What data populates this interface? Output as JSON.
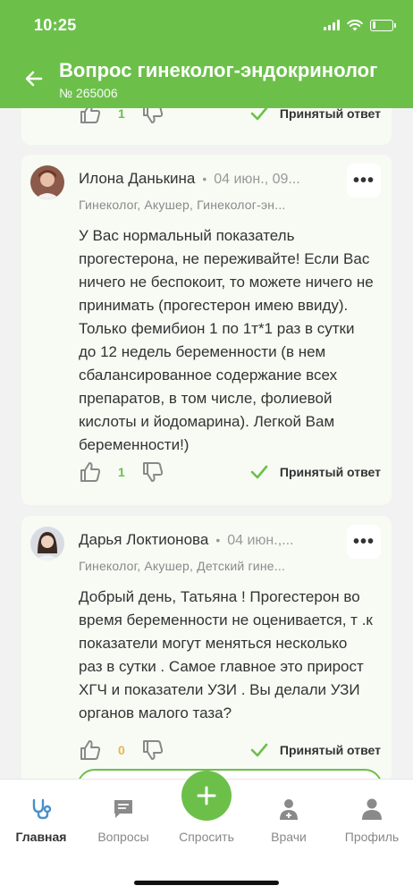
{
  "status_bar": {
    "time": "10:25"
  },
  "header": {
    "title": "Вопрос гинеколог-эндокринолог",
    "subtitle": "№ 265006"
  },
  "top_card": {
    "likes": "1",
    "accepted_label": "Принятый ответ"
  },
  "answers": [
    {
      "name": "Илона Данькина",
      "date": "04 июн., 09...",
      "specialty": "Гинеколог, Акушер, Гинеколог-эн...",
      "text": "У Вас нормальный показатель прогестерона, не переживайте! Если Вас ничего не беспокоит, то можете ничего не принимать (прогестерон имею ввиду). Только фемибион 1 по 1т*1 раз в сутки до 12 недель беременности (в нем сбалансированное содержание всех препаратов, в том числе, фолиевой кислоты и йодомарина). Легкой Вам беременности!)",
      "likes": "1",
      "accepted_label": "Принятый ответ"
    },
    {
      "name": "Дарья Локтионова",
      "date": "04 июн.,...",
      "specialty": "Гинеколог, Акушер, Детский гине...",
      "text": "Добрый день, Татьяна ! Прогестерон во время беременности не оценивается, т .к показатели могут меняться несколько раз в сутки . Самое главное это прирост ХГЧ и показатели УЗИ . Вы делали УЗИ органов малого таза?",
      "likes": "0",
      "accepted_label": "Принятый ответ"
    }
  ],
  "tabbar": {
    "home": "Главная",
    "questions": "Вопросы",
    "ask": "Спросить",
    "doctors": "Врачи",
    "profile": "Профиль"
  },
  "colors": {
    "accent": "#6cc04a",
    "zero_likes": "#e9b44c"
  }
}
